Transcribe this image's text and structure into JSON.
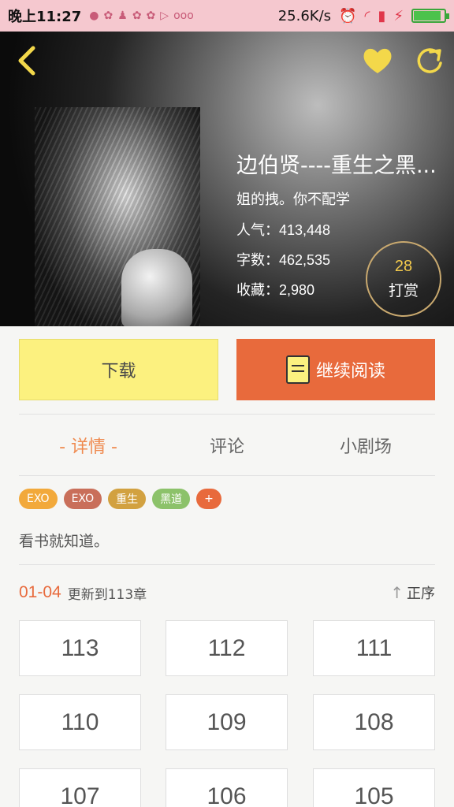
{
  "status_bar": {
    "time": "晚上11:27",
    "network_speed": "25.6K/s",
    "battery_level": 0.9
  },
  "book": {
    "title": "边伯贤----重生之黑...",
    "author": "姐的拽。你不配学",
    "popularity_label": "人气：",
    "popularity": "413,448",
    "words_label": "字数：",
    "words": "462,535",
    "favorites_label": "收藏：",
    "favorites": "2,980"
  },
  "reward": {
    "count": "28",
    "label": "打赏"
  },
  "actions": {
    "download_label": "下载",
    "read_label": "继续阅读"
  },
  "tabs": [
    {
      "label": "- 详情 -",
      "active": true
    },
    {
      "label": "评论",
      "active": false
    },
    {
      "label": "小剧场",
      "active": false
    }
  ],
  "tags": [
    {
      "label": "EXO",
      "color": "#f2a93b"
    },
    {
      "label": "EXO",
      "color": "#c96f5a"
    },
    {
      "label": "重生",
      "color": "#d2a140"
    },
    {
      "label": "黑道",
      "color": "#8cc26a"
    },
    {
      "label": "+",
      "color": "#e86a3c"
    }
  ],
  "description": "看书就知道。",
  "chapters": {
    "date": "01-04",
    "update_text": "更新到113章",
    "sort_label": "正序",
    "items": [
      "113",
      "112",
      "111",
      "110",
      "109",
      "108",
      "107",
      "106",
      "105"
    ]
  },
  "colors": {
    "accent_orange": "#e86a3c",
    "accent_yellow": "#fcf17f",
    "status_bar_bg": "#f5c8cf"
  }
}
